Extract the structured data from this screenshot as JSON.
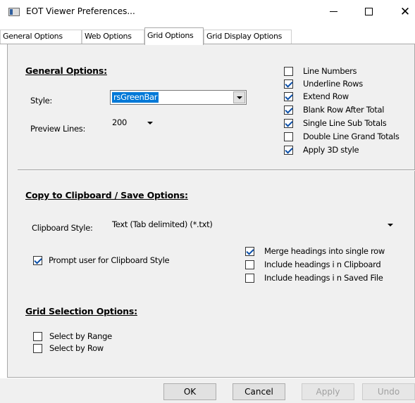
{
  "window": {
    "title": "EOT Viewer Preferences...",
    "close_glyph": "✕"
  },
  "tabs": [
    {
      "label": "General Options",
      "active": false
    },
    {
      "label": "Web Options",
      "active": false
    },
    {
      "label": "Grid Options",
      "active": true
    },
    {
      "label": "Grid Display Options",
      "active": false
    }
  ],
  "general": {
    "heading": "General Options:",
    "style_label": "Style:",
    "style_value": "rsGreenBar",
    "preview_label": "Preview Lines:",
    "preview_value": "200",
    "options": [
      {
        "label": "Line Numbers",
        "checked": false
      },
      {
        "label": "Underline Rows",
        "checked": true
      },
      {
        "label": "Extend Row",
        "checked": true
      },
      {
        "label": "Blank Row After Total",
        "checked": true
      },
      {
        "label": "Single Line Sub Totals",
        "checked": true
      },
      {
        "label": "Double Line Grand Totals",
        "checked": false
      },
      {
        "label": "Apply 3D style",
        "checked": true
      }
    ]
  },
  "clipboard": {
    "heading": "Copy to Clipboard / Save Options:",
    "style_label": "Clipboard Style:",
    "style_value": "Text (Tab delimited) (*.txt)",
    "prompt": {
      "label": "Prompt user for Clipboard Style",
      "checked": true
    },
    "options": [
      {
        "label": "Merge headings into single row",
        "checked": true
      },
      {
        "label": "Include headings i n Clipboard",
        "checked": false
      },
      {
        "label": "Include headings i n Saved File",
        "checked": false
      }
    ]
  },
  "selection": {
    "heading": "Grid Selection Options:",
    "options": [
      {
        "label": "Select by Range",
        "checked": false
      },
      {
        "label": "Select by Row",
        "checked": false
      }
    ]
  },
  "buttons": {
    "ok": "OK",
    "cancel": "Cancel",
    "apply": "Apply",
    "undo": "Undo"
  },
  "colors": {
    "accent": "#0078d7",
    "check": "#0b4fa8",
    "panel_bg": "#f0f0f0"
  }
}
